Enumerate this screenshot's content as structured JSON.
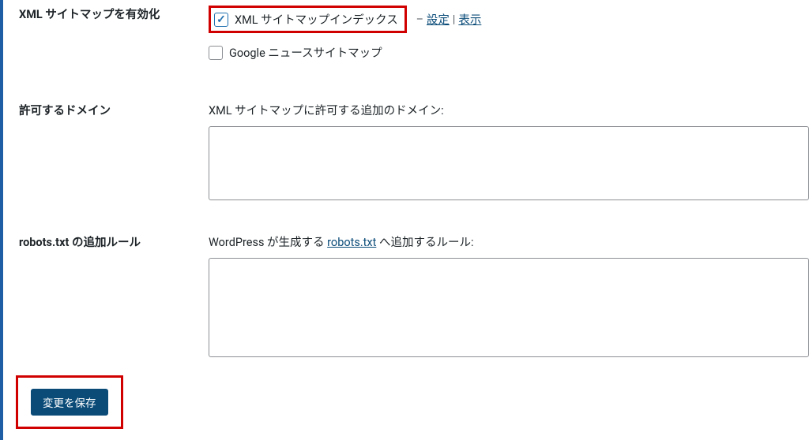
{
  "rows": {
    "enable": {
      "label": "XML サイトマップを有効化",
      "xml_index_label": "XML サイトマップインデックス",
      "settings_link": "設定",
      "view_link": "表示",
      "google_news_label": "Google ニュースサイトマップ"
    },
    "domains": {
      "label": "許可するドメイン",
      "field_label": "XML サイトマップに許可する追加のドメイン:",
      "value": ""
    },
    "robots": {
      "label": "robots.txt の追加ルール",
      "field_label_prefix": "WordPress が生成する ",
      "robots_link": "robots.txt",
      "field_label_suffix": " へ追加するルール:",
      "value": ""
    }
  },
  "actions": {
    "save": "変更を保存"
  },
  "state": {
    "xml_index_checked": true,
    "google_news_checked": false
  }
}
